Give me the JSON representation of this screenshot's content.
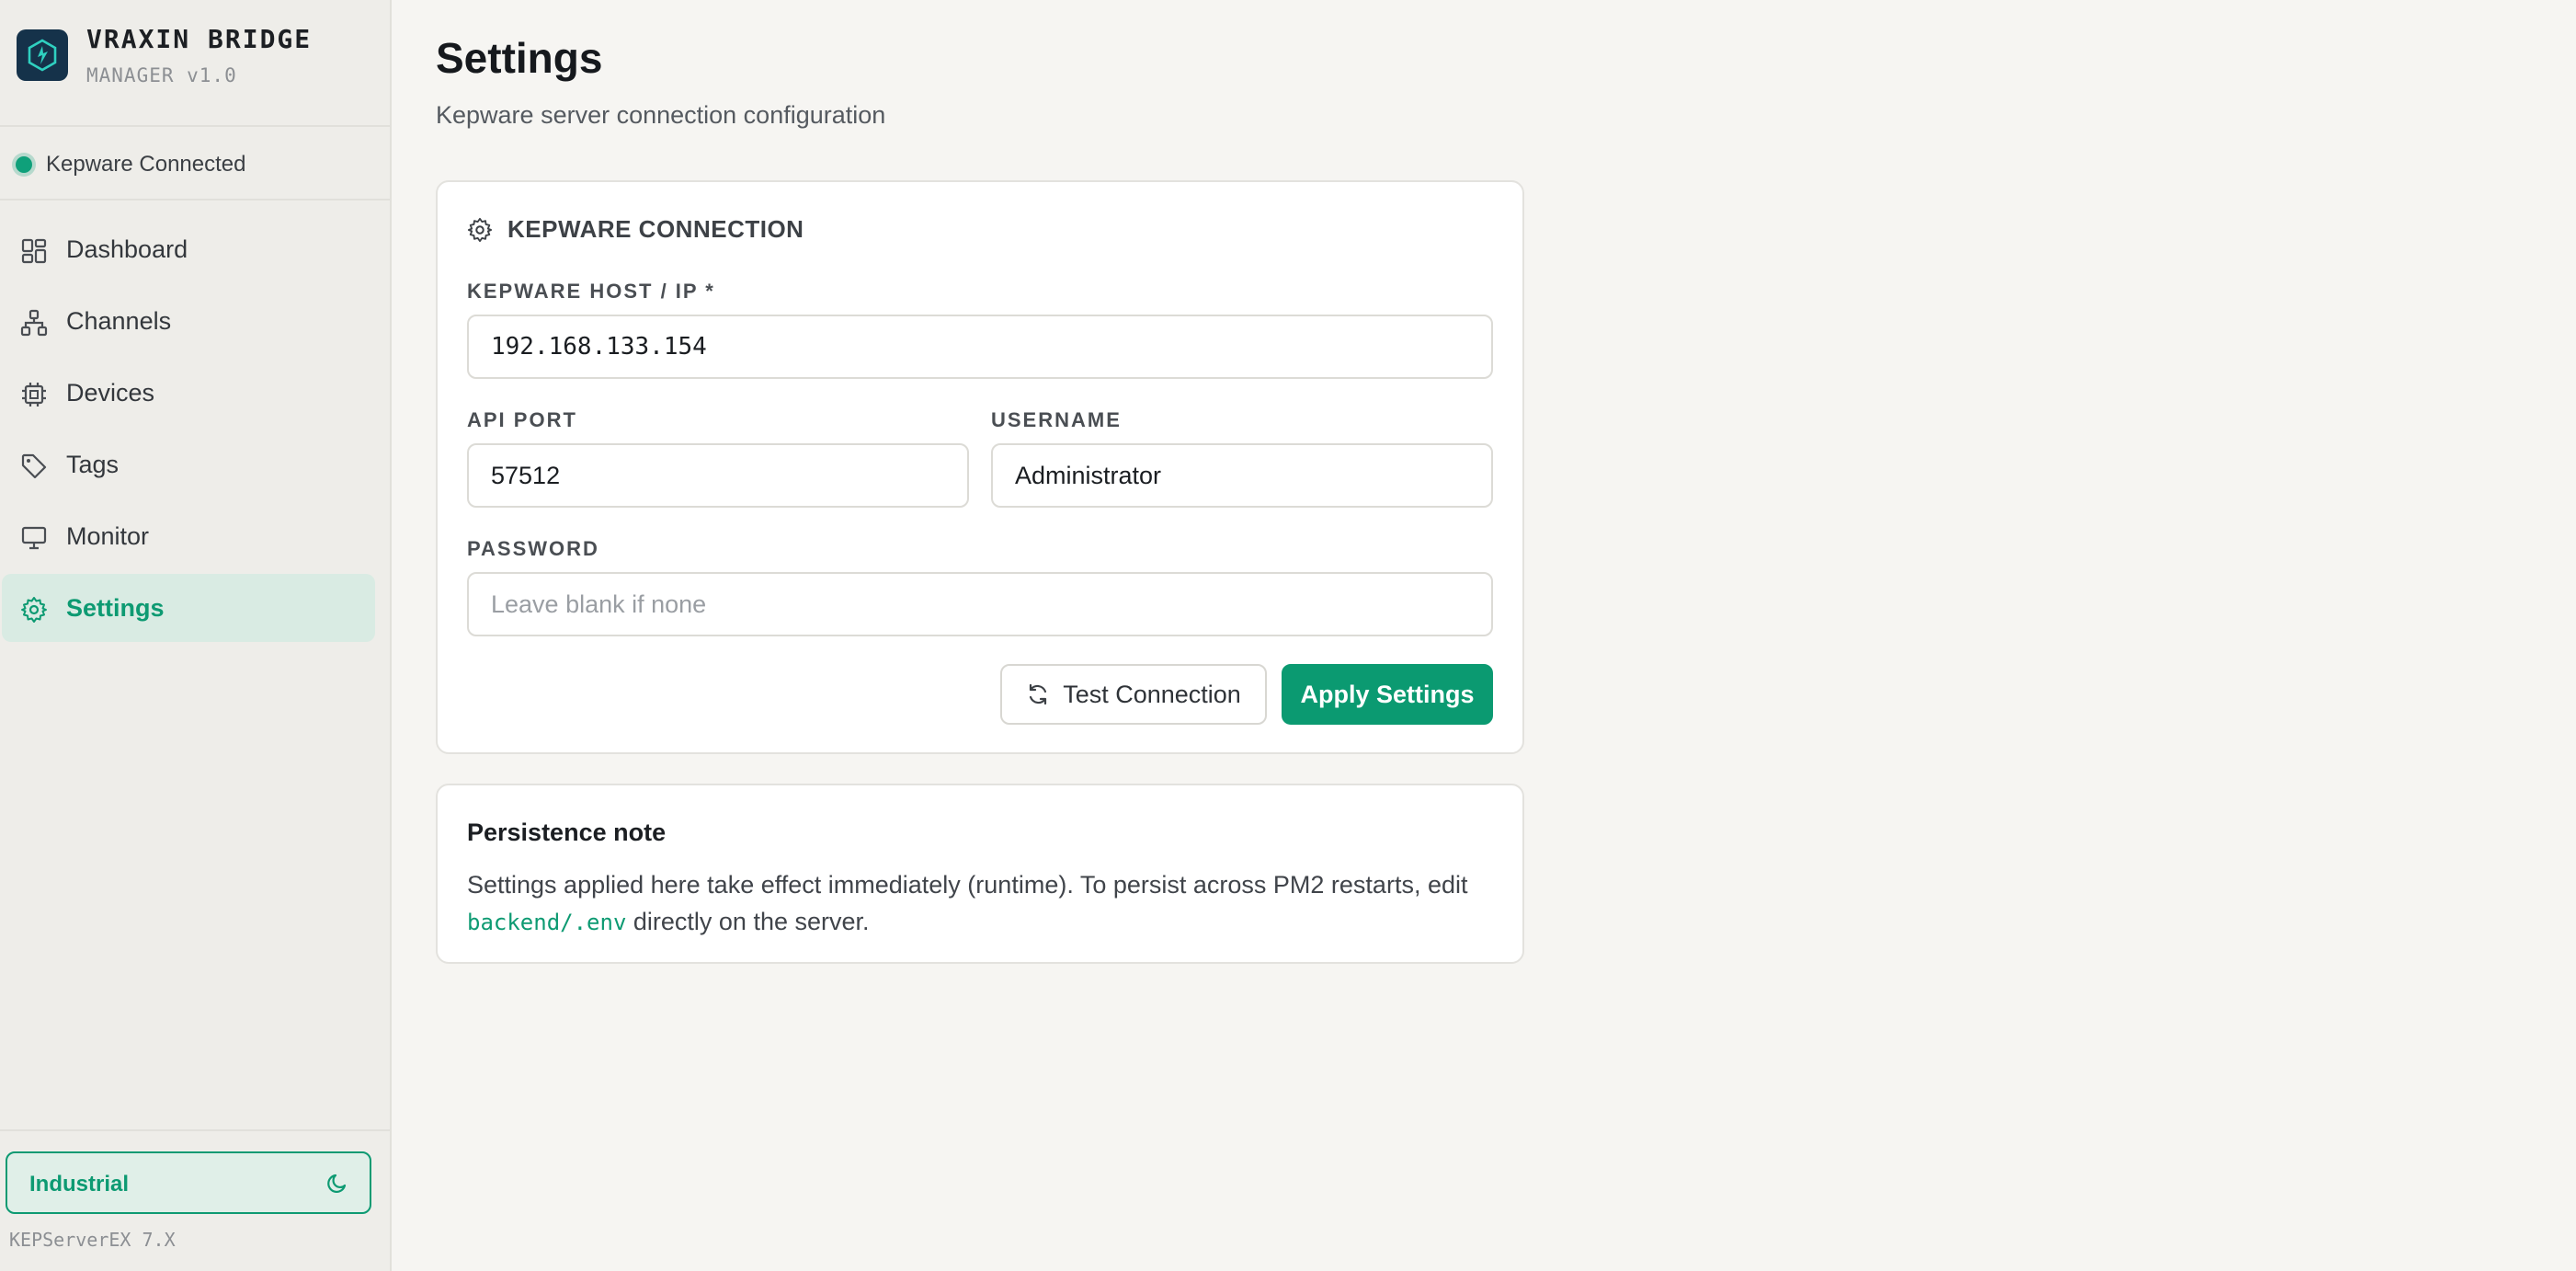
{
  "brand": {
    "title": "VRAXIN BRIDGE",
    "subtitle": "MANAGER v1.0"
  },
  "connection_status": {
    "label": "Kepware Connected",
    "color": "#0fa07a"
  },
  "nav": {
    "items": [
      {
        "label": "Dashboard",
        "icon": "grid-icon"
      },
      {
        "label": "Channels",
        "icon": "network-icon"
      },
      {
        "label": "Devices",
        "icon": "chip-icon"
      },
      {
        "label": "Tags",
        "icon": "tag-icon"
      },
      {
        "label": "Monitor",
        "icon": "monitor-icon"
      },
      {
        "label": "Settings",
        "icon": "gear-icon",
        "active": true
      }
    ]
  },
  "theme": {
    "label": "Industrial",
    "icon": "moon-icon"
  },
  "footer": {
    "version": "KEPServerEX 7.X"
  },
  "page": {
    "title": "Settings",
    "subtitle": "Kepware server connection configuration"
  },
  "connection_card": {
    "heading": "KEPWARE CONNECTION",
    "host_label": "KEPWARE HOST / IP *",
    "host_value": "192.168.133.154",
    "port_label": "API PORT",
    "port_value": "57512",
    "username_label": "USERNAME",
    "username_value": "Administrator",
    "password_label": "PASSWORD",
    "password_placeholder": "Leave blank if none",
    "test_button": "Test Connection",
    "apply_button": "Apply Settings"
  },
  "note_card": {
    "title": "Persistence note",
    "text_before": "Settings applied here take effect immediately (runtime). To persist across PM2 restarts, edit ",
    "code": "backend/.env",
    "text_after": " directly on the server."
  },
  "colors": {
    "accent": "#0b9a71",
    "sidebar_bg": "#eeede9",
    "page_bg": "#f6f5f2"
  }
}
